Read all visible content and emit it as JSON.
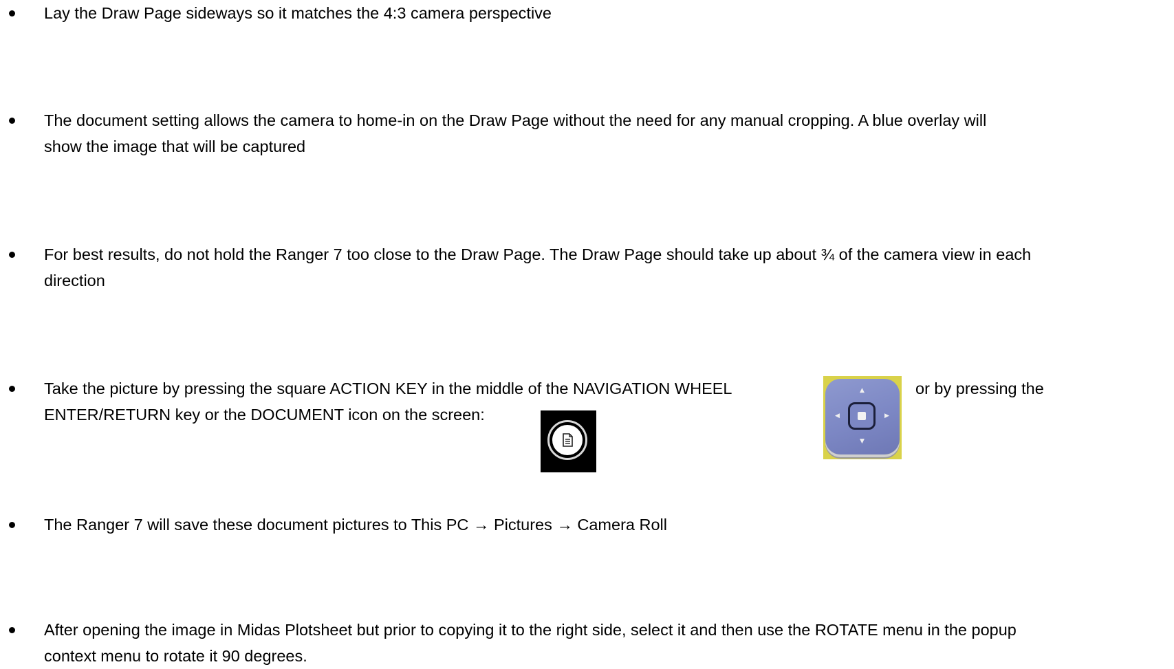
{
  "bullets": [
    {
      "lines": [
        "Lay the Draw Page sideways so it matches the 4:3 camera perspective"
      ]
    },
    {
      "lines": [
        "The document setting allows the camera to home-in on the Draw Page without the need for any manual cropping. A blue overlay will",
        "show the image that will be captured"
      ]
    },
    {
      "lines": [
        "For best results, do not hold the Ranger 7 too close to the Draw Page. The Draw Page should take up about ¾ of the camera view in each",
        "direction"
      ]
    },
    {
      "lines": [
        "Take the picture by pressing the square ACTION KEY in the middle of the NAVIGATION WHEEL",
        "ENTER/RETURN key or the DOCUMENT icon on the screen:"
      ],
      "after_image": "or by pressing the"
    },
    {
      "lines": [
        "The Ranger 7 will save these document pictures to This PC → Pictures → Camera Roll"
      ]
    },
    {
      "lines": [
        "After opening the image in Midas Plotsheet but prior to copying it to the right side, select it and then use the ROTATE menu in the popup",
        "context menu to rotate it 90 degrees."
      ]
    }
  ],
  "images": {
    "navigation_wheel_icon": "navigation-wheel-icon",
    "document_icon": "document-icon"
  }
}
